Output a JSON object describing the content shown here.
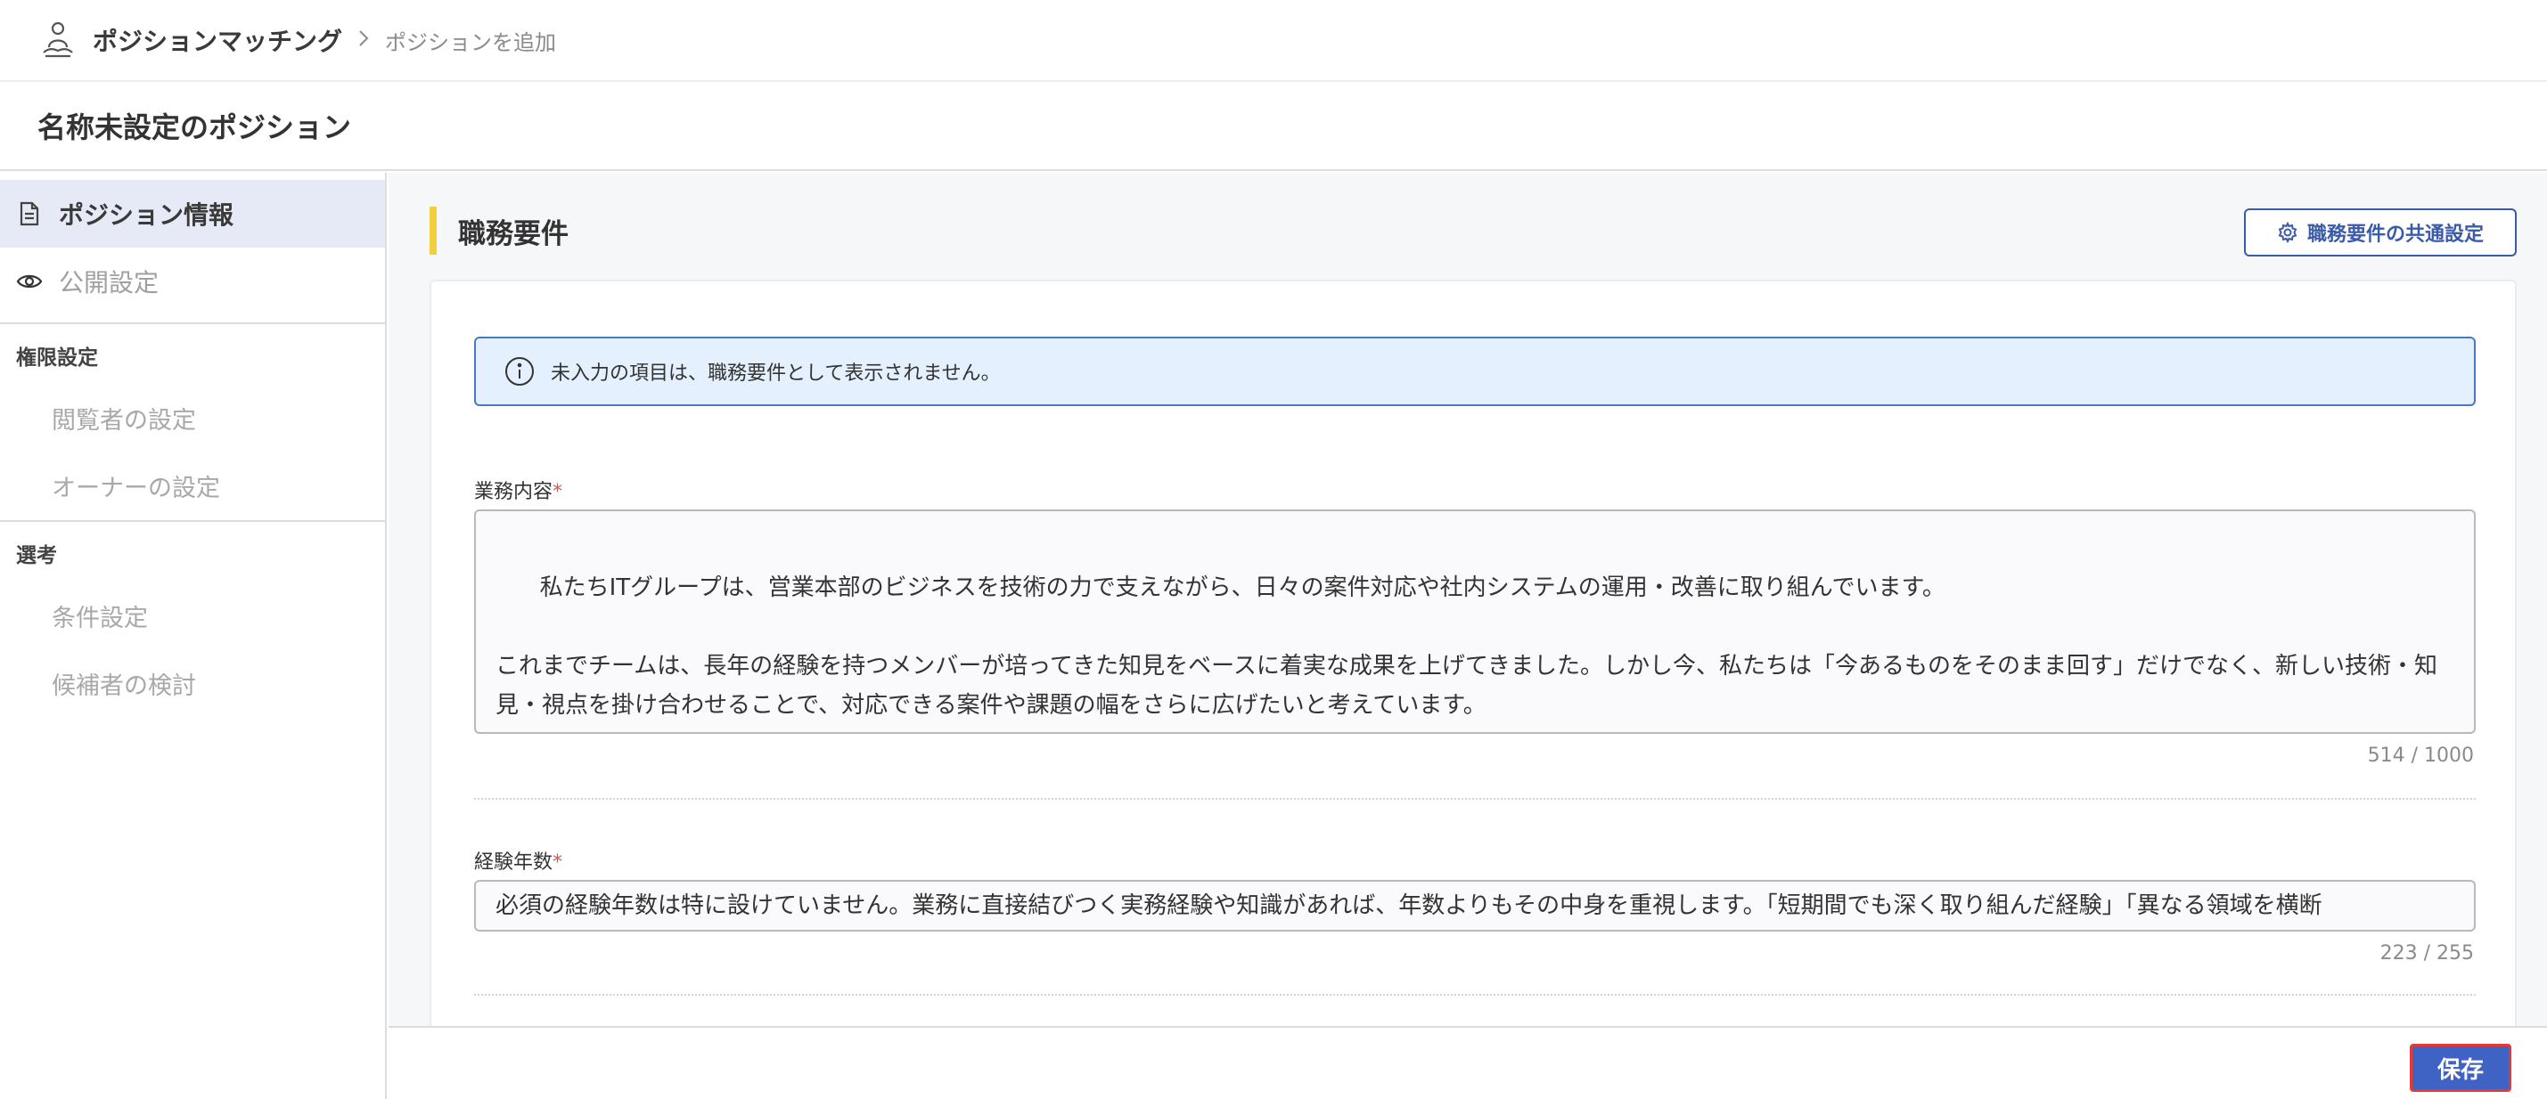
{
  "header": {
    "app_title": "ポジションマッチング",
    "breadcrumb_sep": ">",
    "breadcrumb_current": "ポジションを追加",
    "app_icon": "person-meditation-icon"
  },
  "page": {
    "title": "名称未設定のポジション"
  },
  "sidebar": {
    "items": [
      {
        "label": "ポジション情報",
        "icon": "document-icon",
        "active": true
      },
      {
        "label": "公開設定",
        "icon": "eye-icon",
        "active": false
      }
    ],
    "sections": [
      {
        "title": "権限設定",
        "items": [
          "閲覧者の設定",
          "オーナーの設定"
        ]
      },
      {
        "title": "選考",
        "items": [
          "条件設定",
          "候補者の検討"
        ]
      }
    ]
  },
  "main": {
    "section_title": "職務要件",
    "common_settings_label": "職務要件の共通設定",
    "notice": "未入力の項目は、職務要件として表示されません。",
    "fields": {
      "duties": {
        "label": "業務内容",
        "required_mark": "*",
        "value": "私たちITグループは、営業本部のビジネスを技術の力で支えながら、日々の案件対応や社内システムの運用・改善に取り組んでいます。\n\nこれまでチームは、長年の経験を持つメンバーが培ってきた知見をベースに着実な成果を上げてきました。しかし今、私たちは「今あるものをそのまま回す」だけでなく、新しい技術・知見・視点を掛け合わせることで、対応できる案件や課題の幅をさらに広げたいと考えています。\n\n具体的には、以下のような業務をお任せしたいと考えています。",
        "counter": "514 / 1000"
      },
      "experience": {
        "label": "経験年数",
        "required_mark": "*",
        "value": "必須の経験年数は特に設けていません。業務に直接結びつく実務経験や知識があれば、年数よりもその中身を重視します。「短期間でも深く取り組んだ経験」「異なる領域を横断",
        "counter": "223 / 255"
      }
    }
  },
  "footer": {
    "save_label": "保存"
  },
  "colors": {
    "accent": "#3f62c5",
    "section_bar": "#f2cf3c",
    "notice_bg": "#e4f0fd",
    "required": "#d9534f"
  }
}
